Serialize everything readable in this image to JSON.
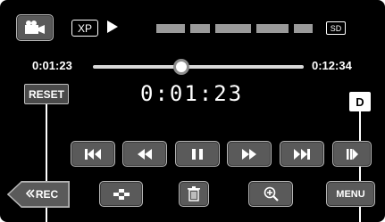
{
  "top_bar": {
    "mode_icon": "video-camera-icon",
    "quality": "XP",
    "play_indicator_icon": "play-icon",
    "media": "SD"
  },
  "timeline": {
    "elapsed": "0:01:23",
    "total": "0:12:34",
    "position_fraction": 0.42
  },
  "counter": {
    "reset_label": "RESET",
    "value": "0:01:23",
    "display_toggle_label": "D"
  },
  "transport": [
    {
      "name": "skip-back",
      "icon": "skip-to-start-icon"
    },
    {
      "name": "rewind",
      "icon": "rewind-icon"
    },
    {
      "name": "pause",
      "icon": "pause-icon"
    },
    {
      "name": "fast-forward",
      "icon": "fast-forward-icon"
    },
    {
      "name": "skip-forward",
      "icon": "skip-to-end-icon"
    },
    {
      "name": "frame-advance",
      "icon": "frame-advance-icon"
    }
  ],
  "bottom_bar": {
    "rec_label": "REC",
    "rec_icon": "double-chevron-left-icon",
    "index_icon": "index-grid-icon",
    "delete_icon": "trash-icon",
    "zoom_icon": "zoom-in-icon",
    "menu_label": "MENU"
  },
  "colors": {
    "background": "#000000",
    "button_fill": "#5a5a5a",
    "button_border": "#b5b5b5",
    "track": "#d9d9d9"
  }
}
